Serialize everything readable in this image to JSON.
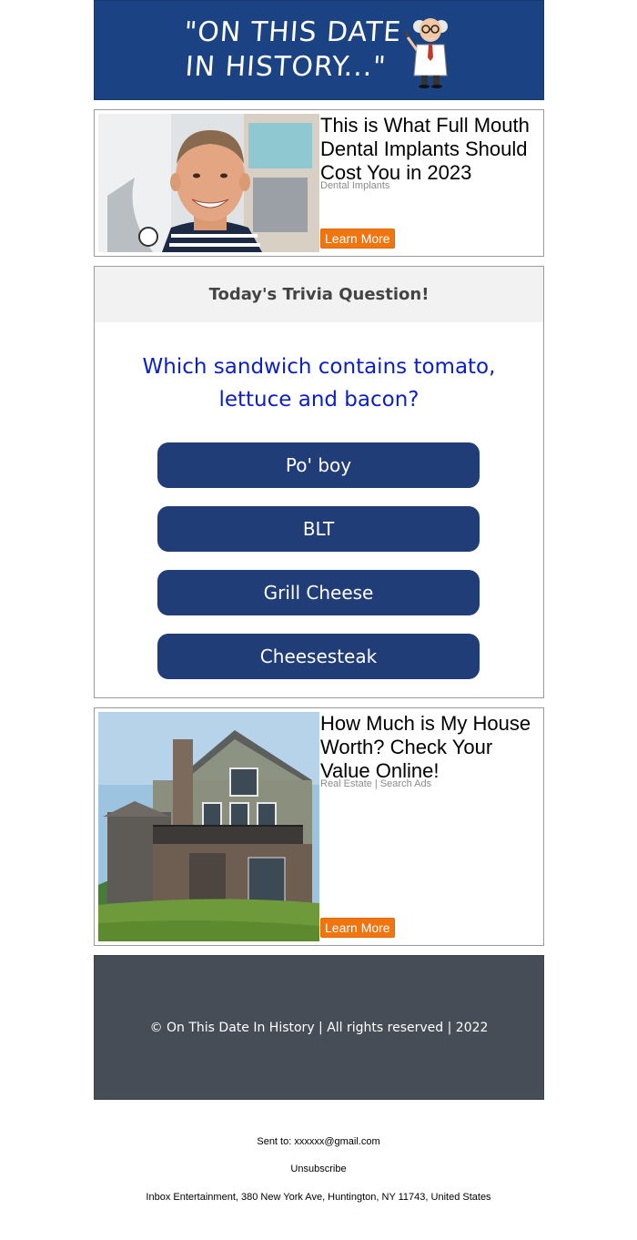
{
  "header": {
    "logo_line1": "\"ON THIS DATE",
    "logo_line2": "IN HISTORY...\"",
    "brand_color": "#1b4282"
  },
  "ad_top": {
    "title": "This is What Full Mouth Dental Implants Should Cost You in 2023",
    "sponsor": "Dental Implants",
    "button": "Learn More"
  },
  "trivia": {
    "heading": "Today's Trivia Question!",
    "question": "Which sandwich contains tomato, lettuce and bacon?",
    "answers": [
      "Po' boy",
      "BLT",
      "Grill Cheese",
      "Cheesesteak"
    ],
    "button_color": "#213d78",
    "question_color": "#0a1fc8"
  },
  "ad_bottom": {
    "title": "How Much is My House Worth? Check Your Value Online!",
    "sponsor": "Real Estate | Search Ads",
    "button": "Learn More"
  },
  "footer": {
    "copyright": "© On This Date In History | All rights reserved | 2022"
  },
  "meta": {
    "sent_to": "Sent to: xxxxxx@gmail.com",
    "unsubscribe": "Unsubscribe",
    "address": "Inbox Entertainment, 380 New York Ave, Huntington, NY 11743, United States"
  },
  "accent_color": "#f0750f"
}
